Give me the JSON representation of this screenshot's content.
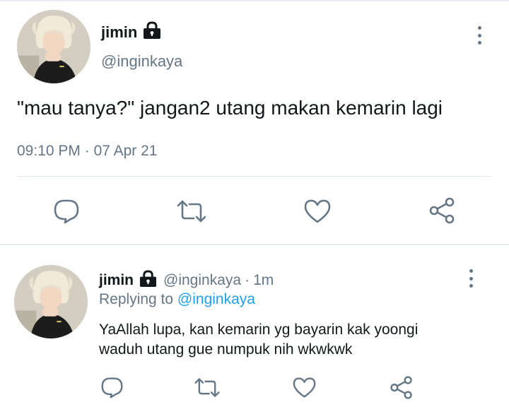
{
  "main_tweet": {
    "author_name": "jimin",
    "author_handle": "@inginkaya",
    "text": "\"mau tanya?\" jangan2 utang makan kemarin lagi",
    "time": "09:10 PM",
    "separator": "·",
    "date": "07 Apr 21",
    "actions": [
      "reply-icon",
      "retweet-icon",
      "like-icon",
      "share-icon"
    ]
  },
  "reply_tweet": {
    "author_name": "jimin",
    "author_handle": "@inginkaya",
    "separator": "·",
    "time_ago": "1m",
    "replying_prefix": "Replying to",
    "replying_to": "@inginkaya",
    "text_line1": "YaAllah lupa, kan kemarin yg bayarin kak yoongi",
    "text_line2": "waduh utang gue numpuk nih wkwkwk",
    "actions": [
      "reply-icon",
      "retweet-icon",
      "like-icon",
      "share-icon"
    ]
  },
  "colors": {
    "text": "#14171a",
    "secondary": "#657786",
    "link": "#1da1f2",
    "divider": "#e1e8ed"
  }
}
